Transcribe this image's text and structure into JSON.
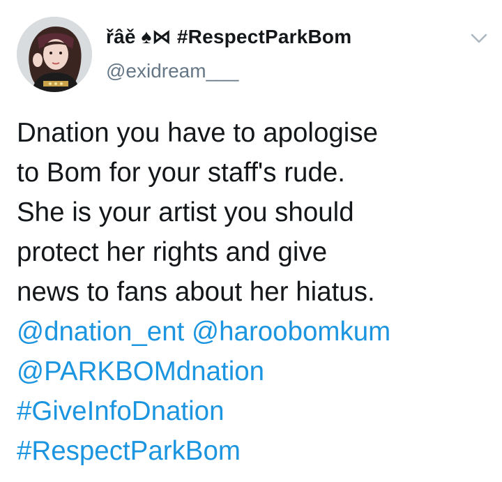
{
  "tweet": {
    "author": {
      "display_name": "řâě ♠⋈ #RespectParkBom",
      "handle": "@exidream___"
    },
    "text_lines": [
      "Dnation you have to apologise",
      "to Bom for your staff's rude.",
      "She is your artist you should",
      "protect her rights and give",
      "news to fans about her hiatus."
    ],
    "mentions": [
      "@dnation_ent",
      "@haroobomkum",
      "@PARKBOMdnation"
    ],
    "hashtags": [
      "#GiveInfoDnation",
      "#RespectParkBom"
    ]
  },
  "colors": {
    "text": "#14171a",
    "muted": "#657786",
    "link": "#1b95e0"
  },
  "icons": {
    "menu": "chevron-down-icon",
    "avatar": "profile-photo"
  }
}
